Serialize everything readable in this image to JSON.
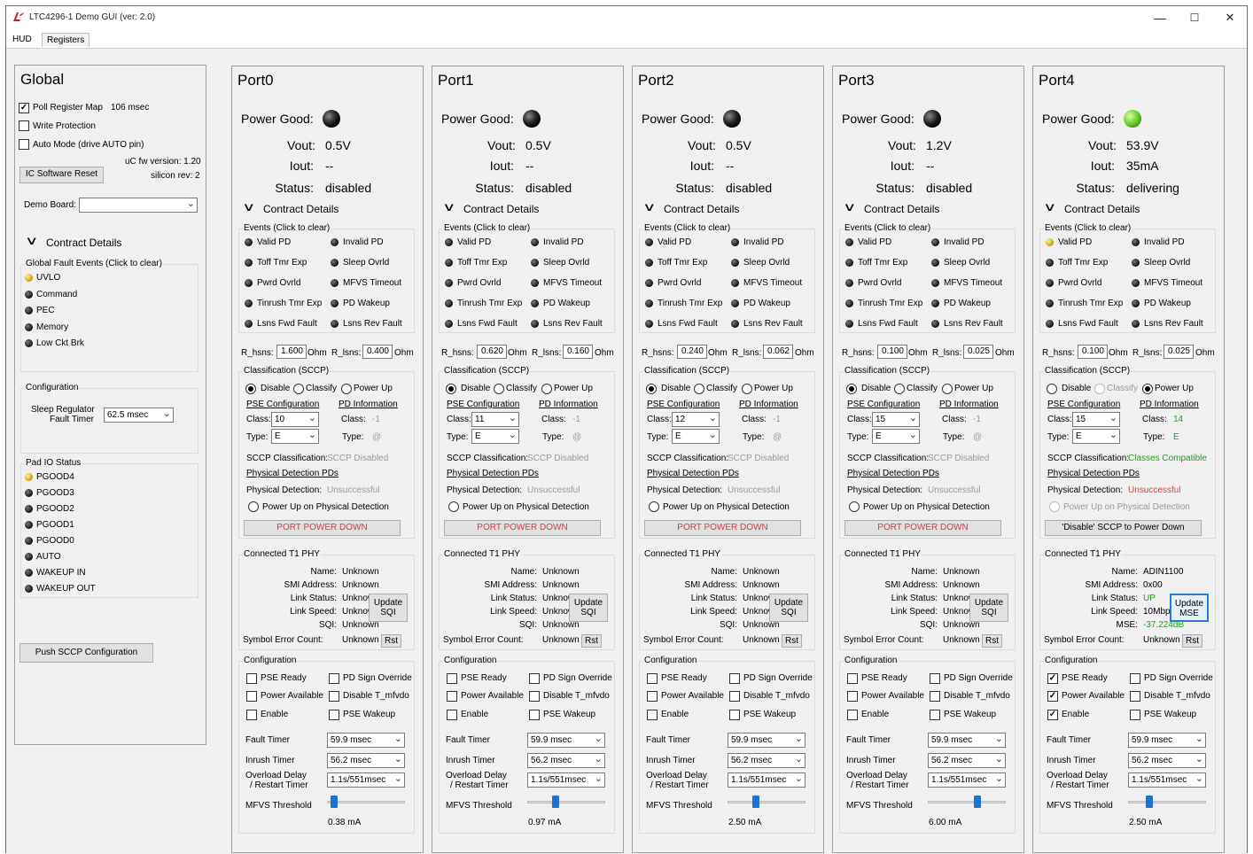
{
  "window": {
    "title": "LTC4296-1 Demo GUI (ver: 2.0)",
    "minimize": "—",
    "maximize": "☐",
    "close": "✕"
  },
  "menu": {
    "hud": "HUD",
    "registers": "Registers"
  },
  "global": {
    "title": "Global",
    "poll_label": "Poll Register Map",
    "poll_value": "106 msec",
    "poll_checked": true,
    "write_protection": "Write Protection",
    "auto_mode": "Auto Mode (drive AUTO pin)",
    "uc_fw": "uC fw version: 1.20",
    "silicon_rev": "silicon rev: 2",
    "reset_button": "IC Software Reset",
    "demo_board_label": "Demo Board:",
    "demo_board_value": "",
    "contract_details": "Contract Details",
    "fault_events_title": "Global Fault Events (Click to clear)",
    "fault_events": [
      {
        "label": "UVLO",
        "led": "yellow"
      },
      {
        "label": "Command",
        "led": "off"
      },
      {
        "label": "PEC",
        "led": "off"
      },
      {
        "label": "Memory",
        "led": "off"
      },
      {
        "label": "Low Ckt Brk",
        "led": "off"
      }
    ],
    "config_title": "Configuration",
    "sleep_regulator": "Sleep Regulator",
    "fault_timer": "Fault Timer",
    "sleep_value": "62.5 msec",
    "pad_io_title": "Pad IO Status",
    "pad_io": [
      {
        "label": "PGOOD4",
        "led": "yellow"
      },
      {
        "label": "PGOOD3",
        "led": "off"
      },
      {
        "label": "PGOOD2",
        "led": "off"
      },
      {
        "label": "PGOOD1",
        "led": "off"
      },
      {
        "label": "PGOOD0",
        "led": "off"
      },
      {
        "label": "AUTO",
        "led": "off"
      },
      {
        "label": "WAKEUP IN",
        "led": "off"
      },
      {
        "label": "WAKEUP OUT",
        "led": "off"
      }
    ],
    "push_button": "Push SCCP Configuration"
  },
  "labels": {
    "power_good": "Power Good:",
    "vout": "Vout:",
    "iout": "Iout:",
    "status": "Status:",
    "contract_details": "Contract Details",
    "events_title": "Events (Click to clear)",
    "events": [
      "Valid PD",
      "Invalid PD",
      "Toff Tmr Exp",
      "Sleep Ovrld",
      "Pwrd Ovrld",
      "MFVS Timeout",
      "Tinrush Tmr Exp",
      "PD Wakeup",
      "Lsns Fwd Fault",
      "Lsns Rev Fault"
    ],
    "r_hsns": "R_hsns:",
    "r_lsns": "R_lsns:",
    "ohm": "Ohm",
    "classification": "Classification (SCCP)",
    "disable": "Disable",
    "classify": "Classify",
    "power_up": "Power Up",
    "pse_config": "PSE Configuration",
    "pd_info": "PD Information",
    "class": "Class:",
    "type": "Type:",
    "sccp_class": "SCCP Classification:",
    "physical_pds": "Physical Detection PDs",
    "physical_detection": "Physical Detection:",
    "power_up_on_pd": "Power Up on Physical Detection",
    "phy_title": "Connected T1 PHY",
    "name": "Name:",
    "smi": "SMI Address:",
    "link_status": "Link Status:",
    "link_speed": "Link Speed:",
    "sqi": "SQI:",
    "mse": "MSE:",
    "symbol_err": "Symbol Error Count:",
    "rst": "Rst",
    "config_title": "Configuration",
    "pse_ready": "PSE Ready",
    "pd_sign_override": "PD Sign Override",
    "power_available": "Power Available",
    "disable_tmfvdo": "Disable T_mfvdo",
    "enable": "Enable",
    "pse_wakeup": "PSE Wakeup",
    "fault_timer": "Fault Timer",
    "inrush_timer": "Inrush Timer",
    "overload_delay": "Overload Delay",
    "restart_timer": "/ Restart Timer",
    "mfvs_threshold": "MFVS Threshold"
  },
  "ports": [
    {
      "title": "Port0",
      "pg": "off",
      "vout": "0.5V",
      "iout": "--",
      "status": "disabled",
      "event_leds": [
        "off",
        "off",
        "off",
        "off",
        "off",
        "off",
        "off",
        "off",
        "off",
        "off"
      ],
      "r_hsns": "1.600",
      "r_lsns": "0.400",
      "mode": "disable",
      "classify_enabled": true,
      "class": "10",
      "pd_class": "-1",
      "type": "E",
      "pd_type": "@",
      "sccp_class": "SCCP Disabled",
      "sccp_color": "gray",
      "phys_det": "Unsuccessful",
      "phys_color": "gray",
      "pd_enabled": true,
      "action_button": "PORT POWER DOWN",
      "action_red": true,
      "phy": {
        "name": "Unknown",
        "smi": "Unknown",
        "link_status": "Unknown",
        "link_status_color": "",
        "link_speed": "Unknown",
        "metric_label": "SQI:",
        "metric": "Unknown",
        "update": "Update SQI",
        "symbol_err": "Unknown",
        "active": false
      },
      "pse_ready": false,
      "power_available": false,
      "enable": false,
      "pd_sign": false,
      "disable_tmfvdo": false,
      "pse_wakeup": false,
      "fault_timer": "59.9 msec",
      "inrush_timer": "56.2 msec",
      "overload": "1.1s/551msec",
      "mfvs_level": 0.05,
      "mfvs_value": "0.38 mA"
    },
    {
      "title": "Port1",
      "pg": "off",
      "vout": "0.5V",
      "iout": "--",
      "status": "disabled",
      "event_leds": [
        "off",
        "off",
        "off",
        "off",
        "off",
        "off",
        "off",
        "off",
        "off",
        "off"
      ],
      "r_hsns": "0.620",
      "r_lsns": "0.160",
      "mode": "disable",
      "classify_enabled": true,
      "class": "11",
      "pd_class": "-1",
      "type": "E",
      "pd_type": "@",
      "sccp_class": "SCCP Disabled",
      "sccp_color": "gray",
      "phys_det": "Unsuccessful",
      "phys_color": "gray",
      "pd_enabled": true,
      "action_button": "PORT POWER DOWN",
      "action_red": true,
      "phy": {
        "name": "Unknown",
        "smi": "Unknown",
        "link_status": "Unknown",
        "link_status_color": "",
        "link_speed": "Unknown",
        "metric_label": "SQI:",
        "metric": "Unknown",
        "update": "Update SQI",
        "symbol_err": "Unknown",
        "active": false
      },
      "pse_ready": false,
      "power_available": false,
      "enable": false,
      "pd_sign": false,
      "disable_tmfvdo": false,
      "pse_wakeup": false,
      "fault_timer": "59.9 msec",
      "inrush_timer": "56.2 msec",
      "overload": "1.1s/551msec",
      "mfvs_level": 0.35,
      "mfvs_value": "0.97 mA"
    },
    {
      "title": "Port2",
      "pg": "off",
      "vout": "0.5V",
      "iout": "--",
      "status": "disabled",
      "event_leds": [
        "off",
        "off",
        "off",
        "off",
        "off",
        "off",
        "off",
        "off",
        "off",
        "off"
      ],
      "r_hsns": "0.240",
      "r_lsns": "0.062",
      "mode": "disable",
      "classify_enabled": true,
      "class": "12",
      "pd_class": "-1",
      "type": "E",
      "pd_type": "@",
      "sccp_class": "SCCP Disabled",
      "sccp_color": "gray",
      "phys_det": "Unsuccessful",
      "phys_color": "gray",
      "pd_enabled": true,
      "action_button": "PORT POWER DOWN",
      "action_red": true,
      "phy": {
        "name": "Unknown",
        "smi": "Unknown",
        "link_status": "Unknown",
        "link_status_color": "",
        "link_speed": "Unknown",
        "metric_label": "SQI:",
        "metric": "Unknown",
        "update": "Update SQI",
        "symbol_err": "Unknown",
        "active": false
      },
      "pse_ready": false,
      "power_available": false,
      "enable": false,
      "pd_sign": false,
      "disable_tmfvdo": false,
      "pse_wakeup": false,
      "fault_timer": "59.9 msec",
      "inrush_timer": "56.2 msec",
      "overload": "1.1s/551msec",
      "mfvs_level": 0.35,
      "mfvs_value": "2.50 mA"
    },
    {
      "title": "Port3",
      "pg": "off",
      "vout": "1.2V",
      "iout": "--",
      "status": "disabled",
      "event_leds": [
        "off",
        "off",
        "off",
        "off",
        "off",
        "off",
        "off",
        "off",
        "off",
        "off"
      ],
      "r_hsns": "0.100",
      "r_lsns": "0.025",
      "mode": "disable",
      "classify_enabled": true,
      "class": "15",
      "pd_class": "-1",
      "type": "E",
      "pd_type": "@",
      "sccp_class": "SCCP Disabled",
      "sccp_color": "gray",
      "phys_det": "Unsuccessful",
      "phys_color": "gray",
      "pd_enabled": true,
      "action_button": "PORT POWER DOWN",
      "action_red": true,
      "phy": {
        "name": "Unknown",
        "smi": "Unknown",
        "link_status": "Unknown",
        "link_status_color": "",
        "link_speed": "Unknown",
        "metric_label": "SQI:",
        "metric": "Unknown",
        "update": "Update SQI",
        "symbol_err": "Unknown",
        "active": false
      },
      "pse_ready": false,
      "power_available": false,
      "enable": false,
      "pd_sign": false,
      "disable_tmfvdo": false,
      "pse_wakeup": false,
      "fault_timer": "59.9 msec",
      "inrush_timer": "56.2 msec",
      "overload": "1.1s/551msec",
      "mfvs_level": 0.65,
      "mfvs_value": "6.00 mA"
    },
    {
      "title": "Port4",
      "pg": "on",
      "vout": "53.9V",
      "iout": "35mA",
      "status": "delivering",
      "event_leds": [
        "yellow",
        "off",
        "off",
        "off",
        "off",
        "off",
        "off",
        "off",
        "off",
        "off"
      ],
      "r_hsns": "0.100",
      "r_lsns": "0.025",
      "mode": "power_up",
      "classify_enabled": false,
      "class": "15",
      "pd_class": "14",
      "type": "E",
      "pd_type": "E",
      "sccp_class": "Classes Compatible",
      "sccp_color": "green",
      "phys_det": "Unsuccessful",
      "phys_color": "red",
      "pd_enabled": false,
      "action_button": "'Disable' SCCP to Power Down",
      "action_red": false,
      "phy": {
        "name": "ADIN1100",
        "smi": "0x00",
        "link_status": "UP",
        "link_status_color": "green",
        "link_speed": "10Mbps",
        "metric_label": "MSE:",
        "metric": "-37.224dB",
        "update": "Update MSE",
        "symbol_err": "Unknown",
        "active": true
      },
      "pse_ready": true,
      "power_available": true,
      "enable": true,
      "pd_sign": false,
      "disable_tmfvdo": false,
      "pse_wakeup": false,
      "fault_timer": "59.9 msec",
      "inrush_timer": "56.2 msec",
      "overload": "1.1s/551msec",
      "mfvs_level": 0.25,
      "mfvs_value": "2.50 mA"
    }
  ]
}
